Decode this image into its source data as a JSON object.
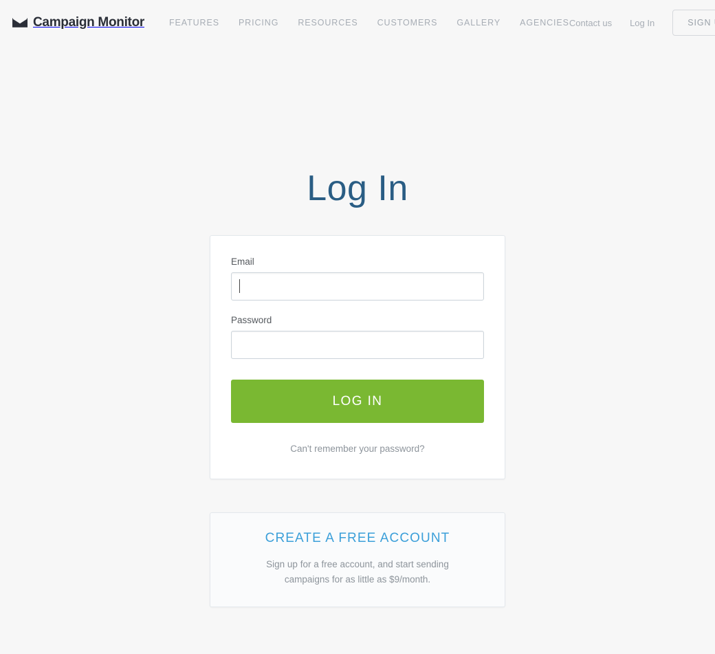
{
  "header": {
    "brand": {
      "name": "Campaign Monitor",
      "icon": "mail-icon"
    },
    "nav": [
      {
        "label": "FEATURES"
      },
      {
        "label": "PRICING"
      },
      {
        "label": "RESOURCES"
      },
      {
        "label": "CUSTOMERS"
      },
      {
        "label": "GALLERY"
      },
      {
        "label": "AGENCIES"
      }
    ],
    "contact_label": "Contact us",
    "login_label": "Log In",
    "signup_label": "SIGN UP"
  },
  "main": {
    "title": "Log In",
    "form": {
      "email_label": "Email",
      "email_value": "",
      "email_placeholder": "",
      "password_label": "Password",
      "password_value": "",
      "password_placeholder": "",
      "submit_label": "LOG IN",
      "forgot_label": "Can't remember your password?"
    },
    "promo": {
      "title": "CREATE A FREE ACCOUNT",
      "line1": "Sign up for a free account, and start sending",
      "line2": "campaigns for as little as $9/month."
    }
  },
  "colors": {
    "page_background": "#f7f7f7",
    "heading_blue": "#2a5d84",
    "accent_green": "#7ab832",
    "link_blue": "#3b9fd9",
    "muted_text": "#8d949b",
    "nav_text": "#a7adb5",
    "border": "#e3e8ec"
  }
}
